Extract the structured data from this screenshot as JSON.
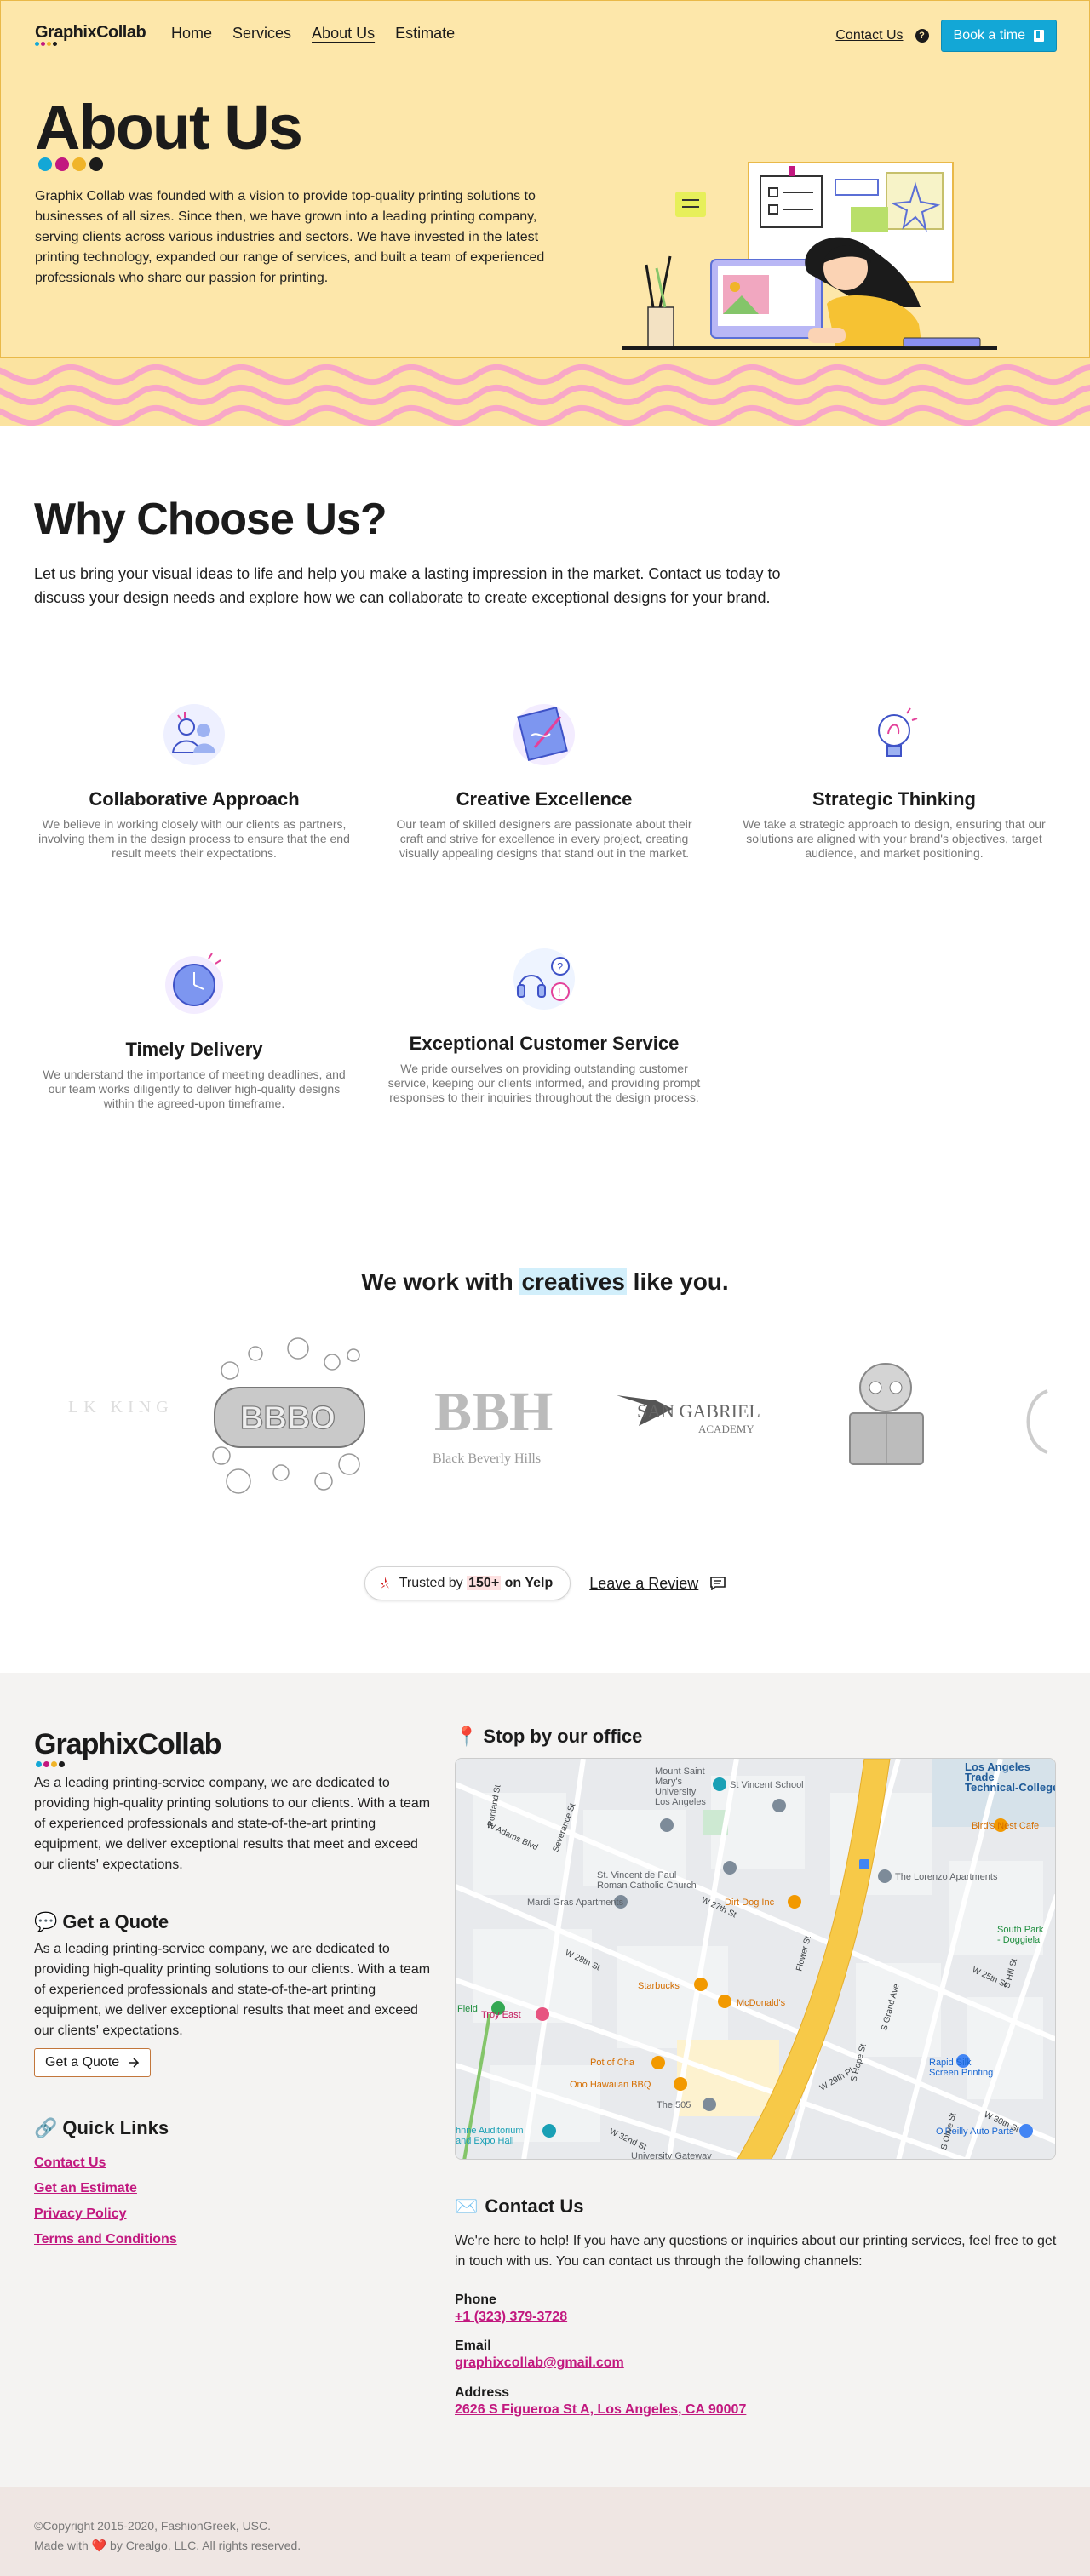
{
  "nav": {
    "logo": "GraphixCollab",
    "links": [
      {
        "label": "Home"
      },
      {
        "label": "Services"
      },
      {
        "label": "About Us"
      },
      {
        "label": "Estimate"
      }
    ],
    "contact": "Contact Us",
    "book": "Book a time"
  },
  "hero": {
    "title": "About Us",
    "text": "Graphix Collab was founded with a vision to provide top-quality printing solutions to businesses of all sizes. Since then, we have grown into a leading printing company, serving clients across various industries and sectors. We have invested in the latest printing technology, expanded our range of services, and built a team of experienced professionals who share our passion for printing."
  },
  "why": {
    "title": "Why Choose Us?",
    "text": "Let us bring your visual ideas to life and help you make a lasting impression in the market. Contact us today to discuss your design needs and explore how we can collaborate to create exceptional designs for your brand.",
    "features": [
      {
        "title": "Collaborative Approach",
        "text": "We believe in working closely with our clients as partners, involving them in the design process to ensure that the end result meets their expectations."
      },
      {
        "title": "Creative Excellence",
        "text": "Our team of skilled designers are passionate about their craft and strive for excellence in every project, creating visually appealing designs that stand out in the market."
      },
      {
        "title": "Strategic Thinking",
        "text": "We take a strategic approach to design, ensuring that our solutions are aligned with your brand's objectives, target audience, and market positioning."
      },
      {
        "title": "Timely Delivery",
        "text": "We understand the importance of meeting deadlines, and our team works diligently to deliver high-quality designs within the agreed-upon timeframe."
      },
      {
        "title": "Exceptional Customer Service",
        "text": "We pride ourselves on providing outstanding customer service, keeping our clients informed, and providing prompt responses to their inquiries throughout the design process."
      }
    ]
  },
  "creatives": {
    "before": "We work with ",
    "highlight": "creatives",
    "after": " like you.",
    "logos": [
      "LK KING",
      "BBBO",
      "BBH",
      "Black Beverly Hills",
      "SAN GABRIEL",
      "ACADEMY"
    ]
  },
  "yelp": {
    "prefix": "Trusted by ",
    "count": "150+",
    "suffix": " on Yelp",
    "review": "Leave a Review"
  },
  "footer": {
    "logo": "GraphixCollab",
    "about": "As a leading printing-service company, we are dedicated to providing high-quality printing solutions to our clients. With a team of experienced professionals and state-of-the-art printing equipment, we deliver exceptional results that meet and exceed our clients' expectations.",
    "quote_title": "Get a Quote",
    "quote_text": "As a leading printing-service company, we are dedicated to providing high-quality printing solutions to our clients. With a team of experienced professionals and state-of-the-art printing equipment, we deliver exceptional results that meet and exceed our clients' expectations.",
    "quote_button": "Get a Quote",
    "quick_links_title": "Quick Links",
    "quick_links": [
      "Contact Us",
      "Get an Estimate",
      "Privacy Policy",
      "Terms and Conditions"
    ],
    "map_title": "Stop by our office",
    "map_labels": {
      "la_trade": "Los Angeles\nTrade\nTechnical-College",
      "mount_saint": "Mount Saint\nMary's\nUniversity\nLos Angeles",
      "st_vincent_school": "St Vincent School",
      "birds_nest": "Bird's Nest Cafe",
      "st_vincent_church": "St. Vincent de Paul\nRoman Catholic Church",
      "lorenzo": "The Lorenzo Apartments",
      "mardi_gras": "Mardi Gras Apartments",
      "dirt_dog": "Dirt Dog Inc",
      "south_park": "South Park\n- Doggiela",
      "starbucks": "Starbucks",
      "mcdonalds": "McDonald's",
      "field": "Field",
      "troy_east": "Troy East",
      "rapid_silk": "Rapid Silk\nScreen Printing",
      "pot_of_cha": "Pot of Cha",
      "ono": "Ono Hawaiian BBQ",
      "the_505": "The 505",
      "oreilly": "O'Reilly Auto Parts",
      "auditorium": "hnne Auditorium\nand Expo Hall",
      "univ_gateway": "University Gateway",
      "adams": "W Adams Blvd",
      "w28": "W 28th St",
      "w27": "W 27th St",
      "w25": "W 25th St",
      "w30": "W 30th St",
      "w29": "W 29th Pl",
      "w32": "W 32nd St",
      "flower": "Flower St",
      "hope": "S Hope St",
      "grand": "S Grand Ave",
      "hill": "S Hill St",
      "olive": "S Olive St",
      "portland": "Portland St",
      "severance": "Severance St"
    },
    "contact_title": "Contact Us",
    "contact_text": "We're here to help! If you have any questions or inquiries about our printing services, feel free to get in touch with us. You can contact us through the following channels:",
    "phone_label": "Phone",
    "phone": "+1 (323) 379-3728",
    "email_label": "Email",
    "email": "graphixcollab@gmail.com",
    "address_label": "Address",
    "address": "2626 S Figueroa St A, Los Angeles, CA 90007"
  },
  "bottom": {
    "copyright": "©Copyright 2015-2020, FashionGreek, USC.",
    "made_prefix": "Made with ",
    "made_suffix": " by Crealgo, LLC. All rights reserved."
  },
  "colors": {
    "hero_bg": "#fde7aa",
    "accent_blue": "#13a7d6",
    "link_pink": "#c2187f",
    "footer_bg": "#f4f3f2",
    "bottom_bg": "#efe6e3",
    "logo_dots": [
      "#13a7d6",
      "#c2187f",
      "#f0b429",
      "#1b1b1b"
    ]
  },
  "icons": [
    "help-icon",
    "book-icon",
    "yelp-icon",
    "chat-icon",
    "pin-icon",
    "speech-icon",
    "link-icon",
    "envelope-icon",
    "arrow-right-icon",
    "heart-icon"
  ]
}
